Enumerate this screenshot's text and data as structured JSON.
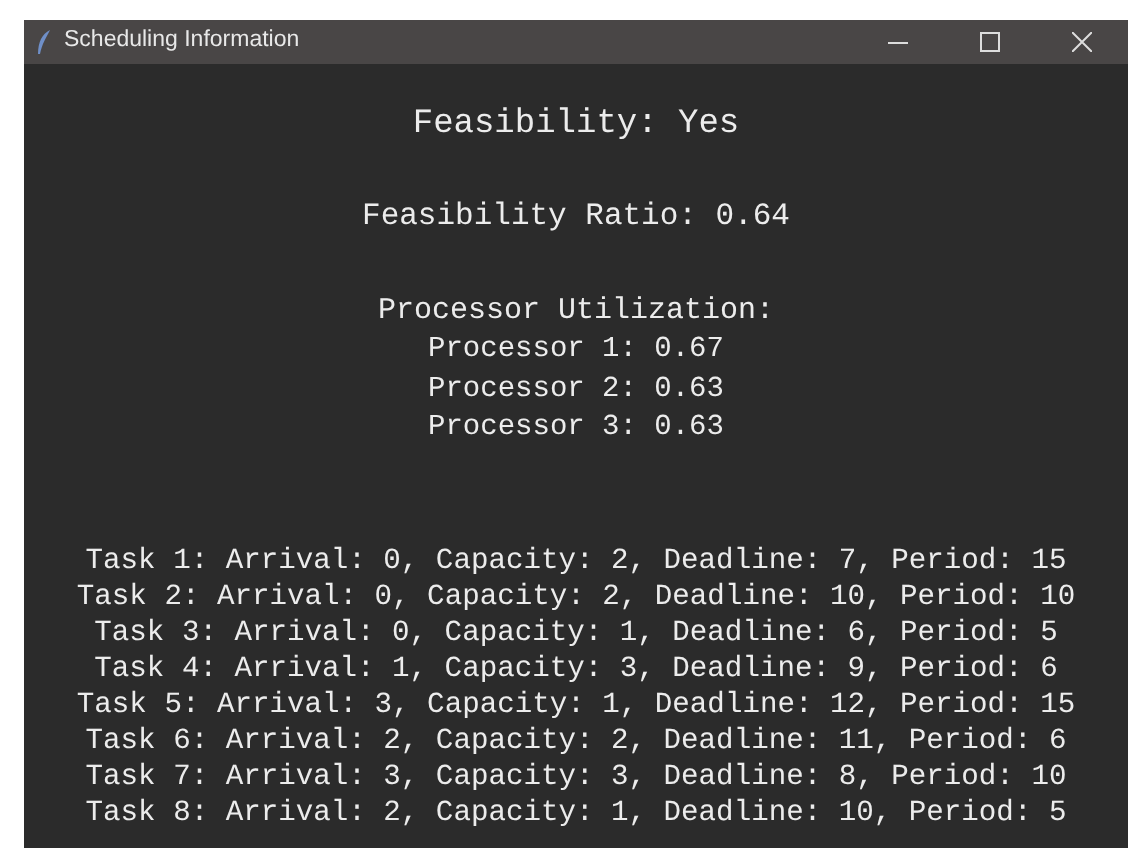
{
  "window": {
    "title": "Scheduling Information"
  },
  "feasibility": "Feasibility: Yes",
  "ratio": "Feasibility Ratio: 0.64",
  "utilization": {
    "heading": "Processor Utilization:",
    "processors": [
      "Processor 1: 0.67",
      "Processor 2: 0.63",
      "Processor 3: 0.63"
    ]
  },
  "tasks": [
    "Task 1: Arrival: 0, Capacity: 2, Deadline: 7, Period: 15",
    "Task 2: Arrival: 0, Capacity: 2, Deadline: 10, Period: 10",
    "Task 3: Arrival: 0, Capacity: 1, Deadline: 6, Period: 5",
    "Task 4: Arrival: 1, Capacity: 3, Deadline: 9, Period: 6",
    "Task 5: Arrival: 3, Capacity: 1, Deadline: 12, Period: 15",
    "Task 6: Arrival: 2, Capacity: 2, Deadline: 11, Period: 6",
    "Task 7: Arrival: 3, Capacity: 3, Deadline: 8, Period: 10",
    "Task 8: Arrival: 2, Capacity: 1, Deadline: 10, Period: 5"
  ]
}
